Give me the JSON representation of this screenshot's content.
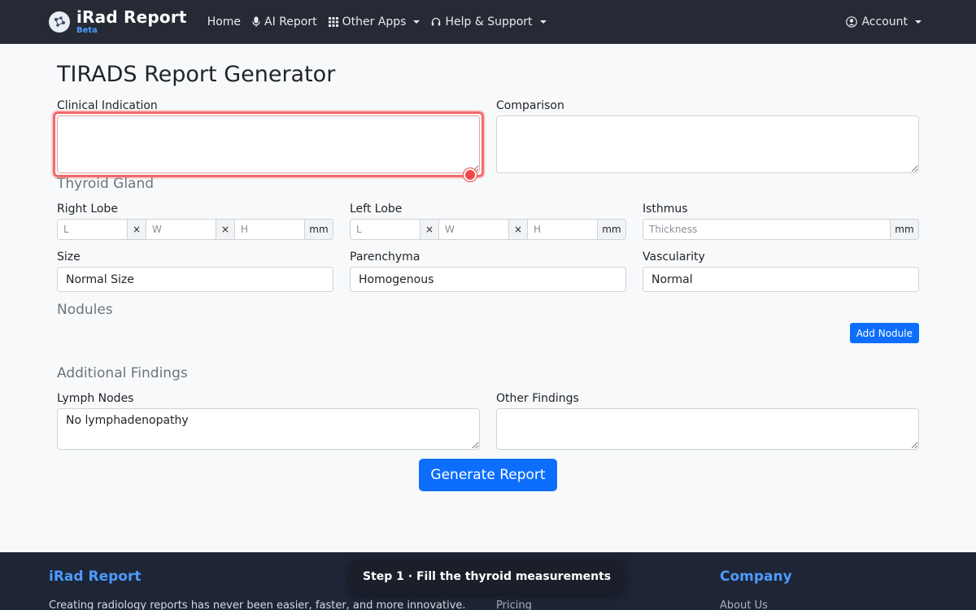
{
  "navbar": {
    "brand_name": "iRad Report",
    "brand_badge": "Beta",
    "links": {
      "home": "Home",
      "ai_report": "AI Report",
      "other_apps": "Other Apps",
      "help": "Help & Support"
    },
    "account": "Account"
  },
  "page": {
    "title": "TIRADS Report Generator"
  },
  "clinical": {
    "indication_label": "Clinical Indication",
    "indication_value": "",
    "comparison_label": "Comparison",
    "comparison_value": ""
  },
  "thyroid": {
    "section_title": "Thyroid Gland",
    "right_lobe": {
      "label": "Right Lobe",
      "placeholders": [
        "L",
        "W",
        "H"
      ],
      "separator": "×",
      "unit": "mm"
    },
    "left_lobe": {
      "label": "Left Lobe",
      "placeholders": [
        "L",
        "W",
        "H"
      ],
      "separator": "×",
      "unit": "mm"
    },
    "isthmus": {
      "label": "Isthmus",
      "placeholder": "Thickness",
      "unit": "mm"
    },
    "size": {
      "label": "Size",
      "value": "Normal Size"
    },
    "parenchyma": {
      "label": "Parenchyma",
      "value": "Homogenous"
    },
    "vascularity": {
      "label": "Vascularity",
      "value": "Normal"
    }
  },
  "nodules": {
    "section_title": "Nodules",
    "add_button": "Add Nodule"
  },
  "additional": {
    "section_title": "Additional Findings",
    "lymph_label": "Lymph Nodes",
    "lymph_value": "No lymphadenopathy",
    "other_label": "Other Findings",
    "other_value": ""
  },
  "actions": {
    "generate": "Generate Report"
  },
  "footer": {
    "brand": "iRad Report",
    "description": "Creating radiology reports has never been easier, faster, and more innovative.",
    "pricing": "Pricing",
    "company": "Company",
    "about": "About Us"
  },
  "toast": {
    "message": "Step 1 · Fill the thyroid measurements"
  },
  "colors": {
    "navbar_bg": "#252a35",
    "primary": "#0d6efd",
    "focus_ring": "#f26a6a",
    "brand_accent": "#4d9bff"
  }
}
